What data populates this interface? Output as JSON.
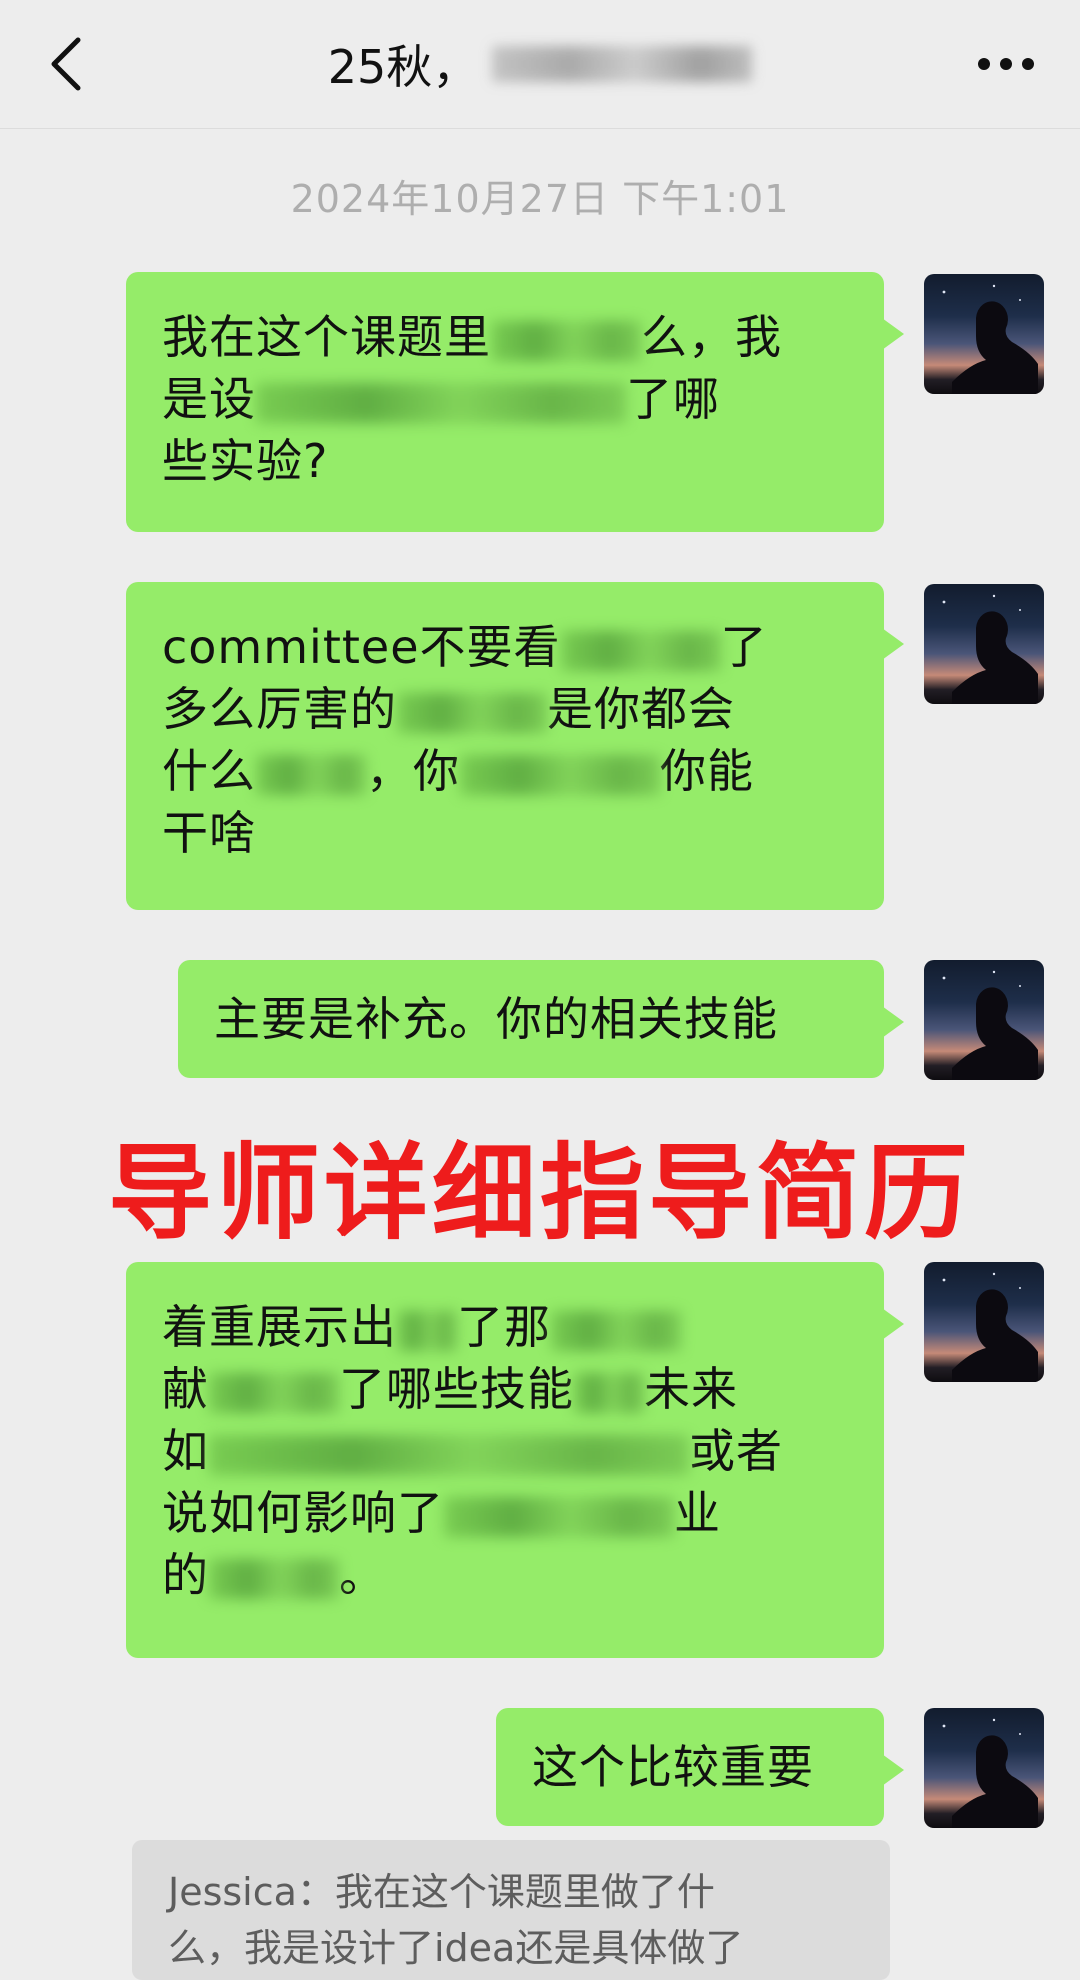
{
  "header": {
    "title": "25秋，",
    "back_icon": "chevron-left-icon",
    "more_icon": "more-dots-icon"
  },
  "timestamps": {
    "first": "2024年10月27日 下午1:01"
  },
  "overlay_text": "导师详细指导简历",
  "messages": [
    {
      "lines": [
        [
          "我在这个课题里",
          "",
          "么，我"
        ],
        [
          "是设",
          "",
          "了哪"
        ],
        [
          "些实验?"
        ]
      ]
    },
    {
      "lines": [
        [
          "committee不要看",
          "",
          "了"
        ],
        [
          "多么厉害的",
          "",
          "是你都会"
        ],
        [
          "什么",
          "",
          "，你",
          "",
          "你能"
        ],
        [
          "干啥"
        ]
      ]
    },
    {
      "lines": [
        [
          "主要是补充。你的相关技能"
        ]
      ]
    },
    {
      "lines": [
        [
          "着重展示出",
          "",
          "了那"
        ],
        [
          "献",
          "",
          "了哪些技能",
          "",
          "未来"
        ],
        [
          "如",
          "",
          "或者"
        ],
        [
          "说如何影响了",
          "",
          "业"
        ],
        [
          "的",
          "",
          "。"
        ]
      ]
    },
    {
      "lines": [
        [
          "这个比较重要"
        ]
      ]
    }
  ],
  "quote": {
    "line1": "Jessica：我在这个课题里做了什",
    "line2": "么，我是设计了idea还是具体做了"
  },
  "colors": {
    "background": "#ededed",
    "bubble_green": "#95ec69",
    "overlay_red": "#ee1c1c",
    "timestamp_gray": "#aeaeae"
  }
}
